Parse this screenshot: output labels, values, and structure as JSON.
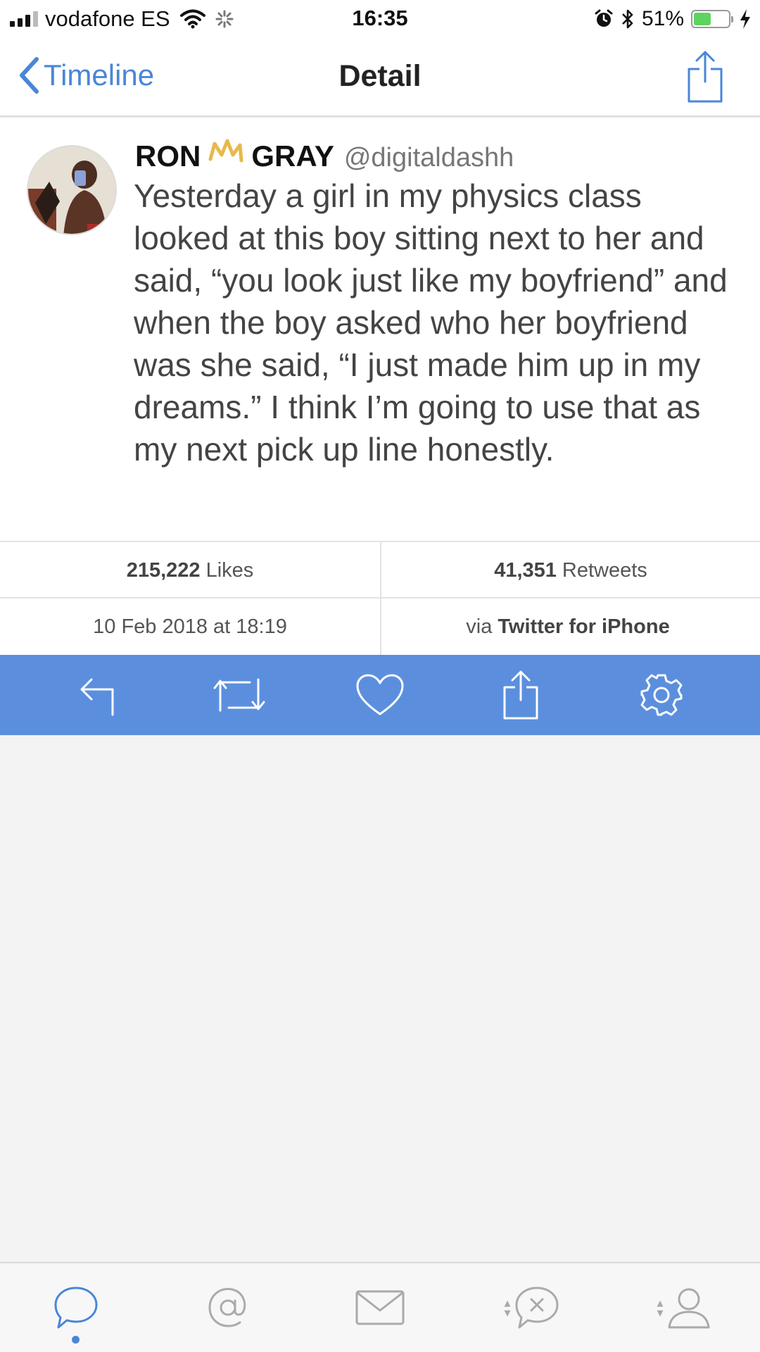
{
  "status_bar": {
    "carrier": "vodafone ES",
    "time": "16:35",
    "battery_percent": "51%",
    "battery_level": 0.51
  },
  "nav": {
    "back_label": "Timeline",
    "title": "Detail"
  },
  "tweet": {
    "author_first": "RON",
    "author_last": "GRAY",
    "handle": "@digitaldashh",
    "text": "Yesterday a girl in my physics class looked at this boy sitting next to her and said, “you look just like my boyfriend” and when the boy asked who her boyfriend was she said, “I just made him up in my dreams.” I think I’m going to use that as my next pick up line honestly."
  },
  "stats": {
    "likes_count": "215,222",
    "likes_label": "Likes",
    "retweets_count": "41,351",
    "retweets_label": "Retweets",
    "timestamp": "10 Feb 2018 at 18:19",
    "via_label": "via",
    "client": "Twitter for iPhone"
  },
  "colors": {
    "accent": "#4a86d8",
    "action_bar": "#5b8fde",
    "battery_fill": "#5fd35f"
  },
  "actions": [
    "reply-icon",
    "retweet-icon",
    "heart-icon",
    "share-icon",
    "gear-icon"
  ],
  "tabs": [
    "timeline-bubble-icon",
    "mentions-at-icon",
    "messages-envelope-icon",
    "muted-bubble-icon",
    "profile-icon"
  ]
}
